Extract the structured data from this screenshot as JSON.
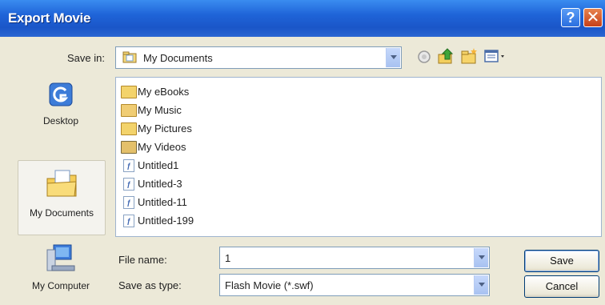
{
  "window": {
    "title": "Export Movie"
  },
  "title_buttons": {
    "help": "?",
    "close": "✕"
  },
  "save_in": {
    "label": "Save in:",
    "value": "My Documents"
  },
  "toolbar": {
    "icons": [
      "back-icon",
      "up-folder-icon",
      "new-folder-icon",
      "view-menu-icon"
    ]
  },
  "places": [
    {
      "label": "Desktop"
    },
    {
      "label": "My Documents"
    },
    {
      "label": "My Computer"
    }
  ],
  "files": [
    {
      "name": "My eBooks",
      "type": "folder"
    },
    {
      "name": "My Music",
      "type": "folder"
    },
    {
      "name": "My Pictures",
      "type": "folder"
    },
    {
      "name": "My Videos",
      "type": "folder"
    },
    {
      "name": "Untitled1",
      "type": "fla"
    },
    {
      "name": "Untitled-3",
      "type": "fla"
    },
    {
      "name": "Untitled-11",
      "type": "fla"
    },
    {
      "name": "Untitled-199",
      "type": "fla"
    }
  ],
  "file_name": {
    "label": "File name:",
    "value": "1"
  },
  "save_as_type": {
    "label": "Save as type:",
    "value": "Flash Movie (*.swf)"
  },
  "buttons": {
    "save": "Save",
    "cancel": "Cancel"
  }
}
